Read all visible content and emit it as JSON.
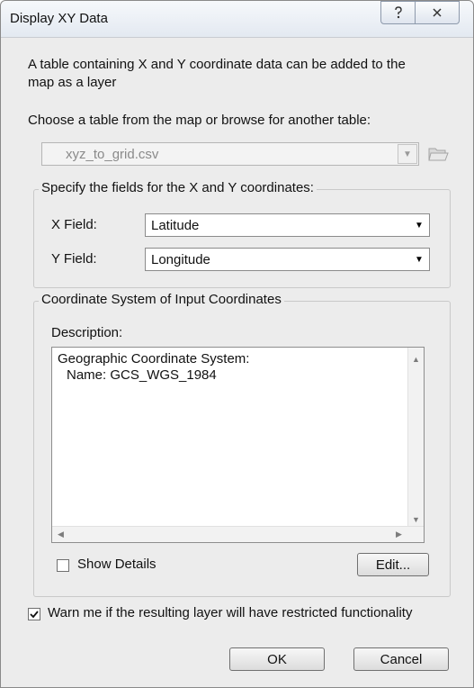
{
  "window": {
    "title": "Display XY Data"
  },
  "intro": {
    "line1": "A table containing X and Y coordinate data can be added to the",
    "line2": "map as a layer"
  },
  "table_section": {
    "label": "Choose a table from the map or browse for another table:",
    "selected_table": "xyz_to_grid.csv"
  },
  "fields_group": {
    "legend": "Specify the fields for the X and Y coordinates:",
    "x_label": "X Field:",
    "x_value": "Latitude",
    "y_label": "Y Field:",
    "y_value": "Longitude"
  },
  "coord_group": {
    "legend": "Coordinate System of Input Coordinates",
    "description_label": "Description:",
    "description_line1": "Geographic Coordinate System:",
    "description_line2": "Name: GCS_WGS_1984",
    "show_details_label": "Show Details",
    "show_details_checked": false,
    "edit_label": "Edit..."
  },
  "warn": {
    "label": "Warn me if the resulting layer will have restricted functionality",
    "checked": true
  },
  "buttons": {
    "ok": "OK",
    "cancel": "Cancel"
  },
  "icons": {
    "help": "help-icon",
    "close": "close-icon",
    "browse": "folder-open-icon",
    "dropdown": "dropdown-arrow-icon"
  }
}
